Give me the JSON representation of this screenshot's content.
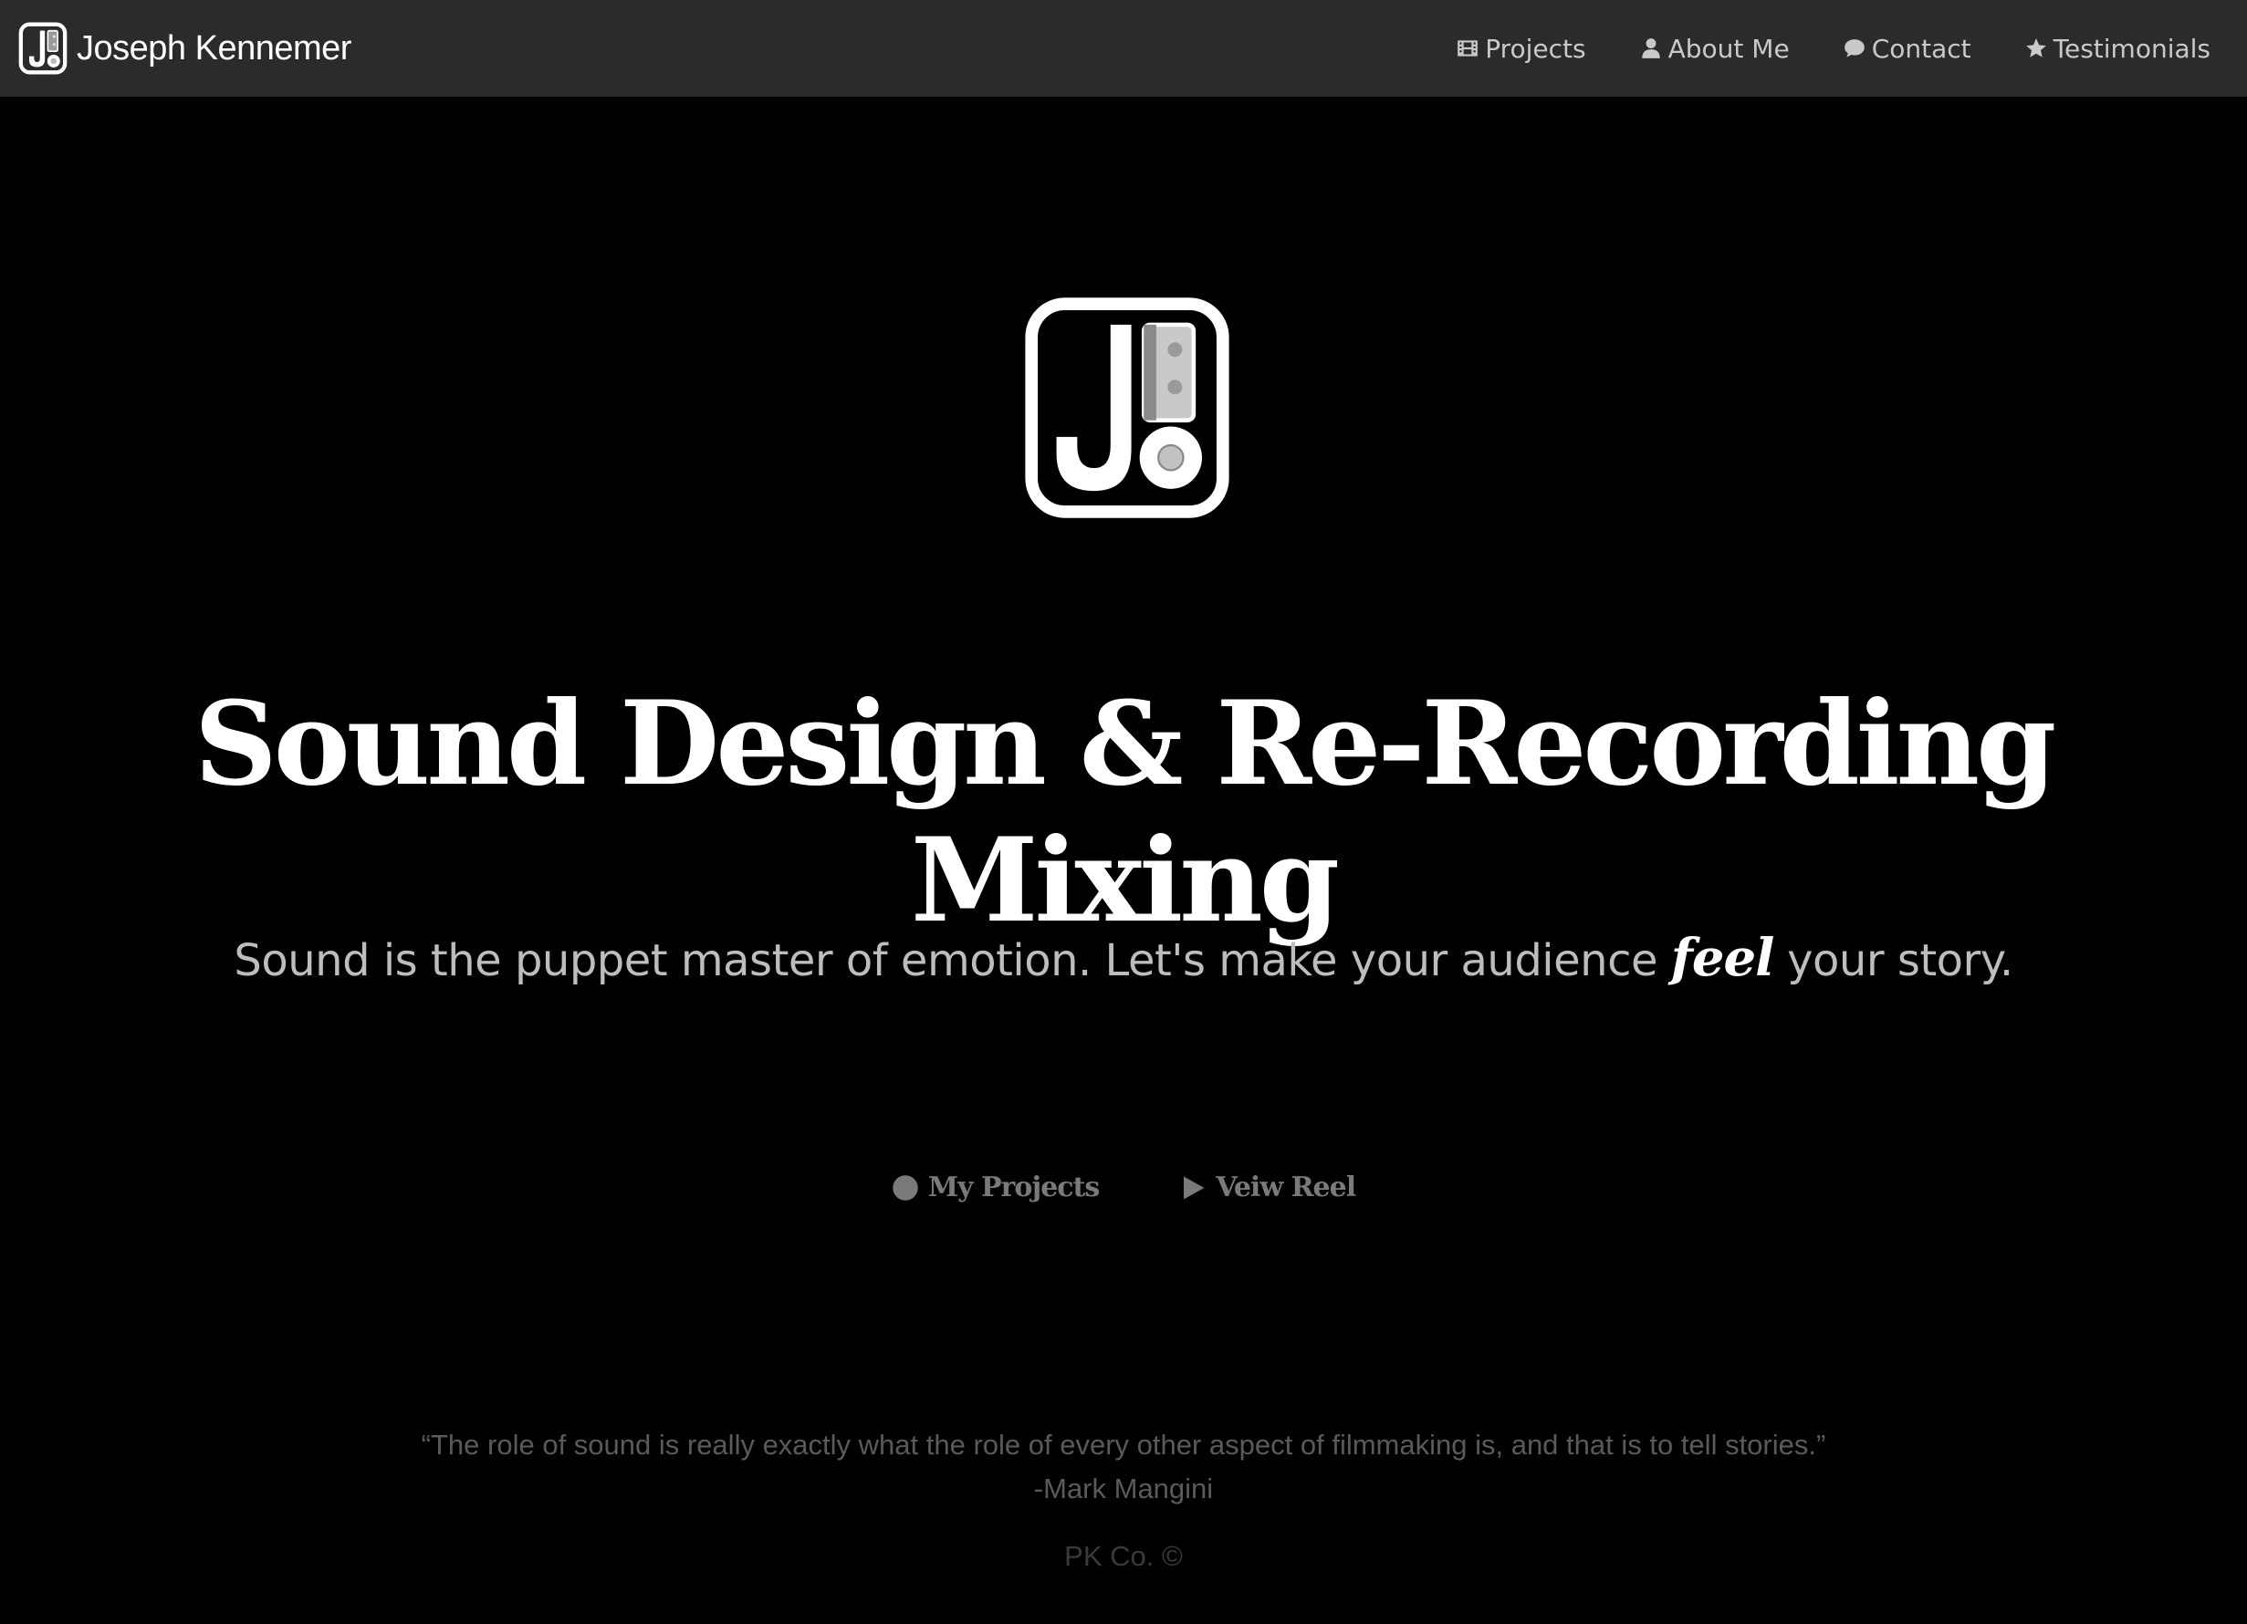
{
  "navbar": {
    "brand_name": "Joseph Kennemer",
    "items": [
      {
        "label": "Projects",
        "icon": "film-icon"
      },
      {
        "label": "About Me",
        "icon": "user-icon"
      },
      {
        "label": "Contact",
        "icon": "comment-icon"
      },
      {
        "label": "Testimonials",
        "icon": "star-icon"
      }
    ]
  },
  "hero": {
    "headline": "Sound Design & Re-Recording Mixing",
    "tagline_before": "Sound is the puppet master of emotion. Let's make your audience ",
    "tagline_emphasis": "feel",
    "tagline_after": " your story.",
    "actions": [
      {
        "label": "My Projects",
        "icon": "circle-icon"
      },
      {
        "label": "Veiw Reel",
        "icon": "play-icon"
      }
    ]
  },
  "quote": {
    "text": "“The role of sound is really exactly what the role of every other aspect of filmmaking is, and that is to tell stories.”",
    "author": "-Mark Mangini"
  },
  "footer": {
    "text": "PK Co. ©"
  },
  "colors": {
    "background": "#000000",
    "navbar": "#2b2b2b",
    "nav_text": "#c9c9c9",
    "tagline": "#bdbdbd",
    "button_text": "#7a7a7a",
    "quote": "#5a5a5a",
    "footer": "#3a3a3a"
  }
}
